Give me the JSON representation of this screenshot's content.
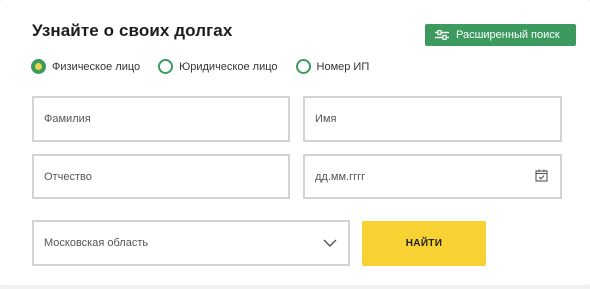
{
  "form": {
    "title": "Узнайте о своих долгах",
    "advanced_search_label": "Расширенный поиск",
    "person_types": [
      {
        "label": "Физическое лицо",
        "selected": true
      },
      {
        "label": "Юридическое лицо",
        "selected": false
      },
      {
        "label": "Номер ИП",
        "selected": false
      }
    ],
    "fields": {
      "surname_placeholder": "Фамилия",
      "name_placeholder": "Имя",
      "patronymic_placeholder": "Отчество",
      "birthdate_placeholder": "дд.мм.гггг",
      "region_value": "Московская область"
    },
    "find_label": "НАЙТИ"
  },
  "icons": {
    "advanced_search": "sliders-icon",
    "date": "calendar-icon",
    "region": "chevron-down-icon"
  },
  "colors": {
    "accent_green": "#3c9a5f",
    "button_yellow": "#f7d232",
    "radio_inner": "#e8d54a",
    "field_border": "#d3d3d3"
  }
}
